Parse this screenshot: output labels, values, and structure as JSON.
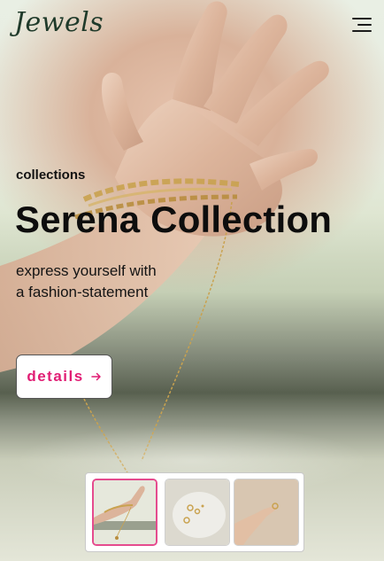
{
  "header": {
    "logo": "Jewels",
    "menu_icon": "hamburger-menu-icon"
  },
  "hero": {
    "eyebrow": "collections",
    "title": "Serena Collection",
    "subtitle_line1": "express yourself with",
    "subtitle_line2": "a fashion-statement",
    "details_label": "details",
    "details_icon": "arrow-right-icon"
  },
  "colors": {
    "accent": "#e11d74",
    "thumb_active_border": "#e54b8e",
    "logo": "#1f3a2a",
    "text": "#0d0d0d"
  },
  "thumbnails": [
    {
      "name": "hand-with-chain-thumbnail",
      "active": true
    },
    {
      "name": "rings-on-plate-thumbnail",
      "active": false
    },
    {
      "name": "hand-holding-ring-thumbnail",
      "active": false
    }
  ]
}
